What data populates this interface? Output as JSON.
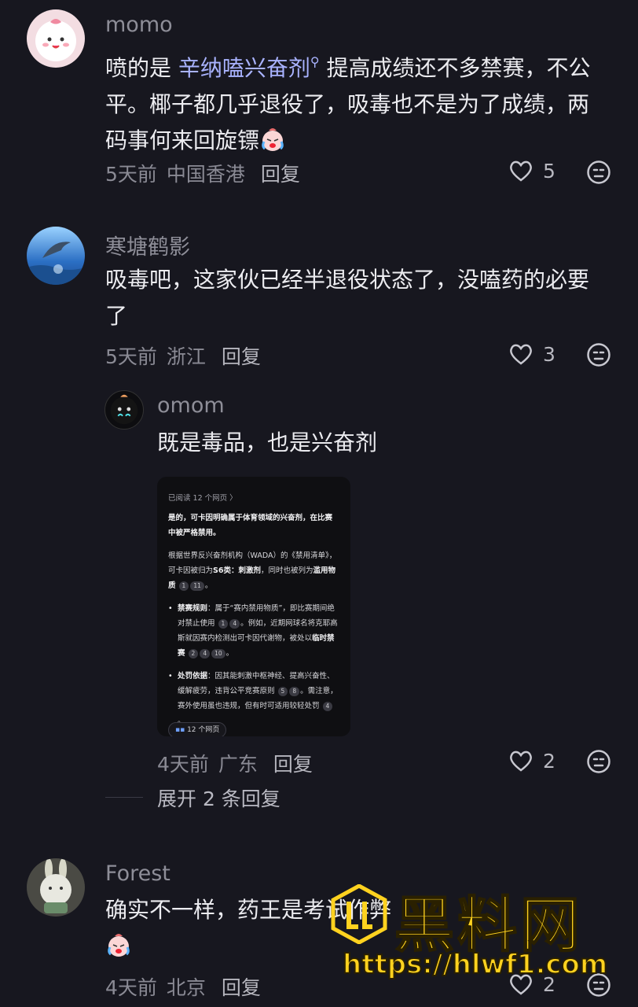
{
  "comments": [
    {
      "username": "momo",
      "text_before": "喷的是 ",
      "link": "辛纳嗑兴奋剂",
      "text_after": " 提高成绩还不多禁赛，不公平。椰子都几乎退役了，吸毒也不是为了成绩，两码事何来回旋镖",
      "time": "5天前",
      "location": "中国香港",
      "reply": "回复",
      "likes": "5"
    },
    {
      "username": "寒塘鹤影",
      "text": "吸毒吧，这家伙已经半退役状态了，没嗑药的必要了",
      "time": "5天前",
      "location": "浙江",
      "reply": "回复",
      "likes": "3"
    },
    {
      "username": "omom",
      "text": "既是毒品，也是兴奋剂",
      "time": "4天前",
      "location": "广东",
      "reply": "回复",
      "likes": "2"
    },
    {
      "username": "Forest",
      "text": "确实不一样，药王是考试作弊",
      "time": "4天前",
      "location": "北京",
      "reply": "回复",
      "likes": "2"
    }
  ],
  "expand_replies": "展开 2 条回复",
  "screenshot": {
    "read_pages": "已阅读 12 个网页 〉",
    "headline": "是的，可卡因明确属于体育领域的兴奋剂，在比赛中被严格禁用。",
    "para1_a": "根据世界反兴奋剂机构（WADA）的《禁用清单》，可卡因被归为",
    "para1_b": "S6类：刺激剂",
    "para1_c": "，同时也被列为",
    "para1_d": "滥用物质",
    "para1_refs": [
      "1",
      "11"
    ],
    "b1_title": "禁赛规则",
    "b1_text": "：属于“赛内禁用物质”，即比赛期间绝对禁止使用",
    "b1_refs": [
      "1",
      "4"
    ],
    "b1_text2": "。例如，近期网球名将克耶高斯就因赛内检测出可卡因代谢物，被处以",
    "b1_bold": "临时禁赛",
    "b1_refs2": [
      "2",
      "4",
      "10"
    ],
    "b2_title": "处罚依据",
    "b2_text": "：因其能刺激中枢神经、提高兴奋性、缓解疲劳，违背公平竞赛原则",
    "b2_refs": [
      "5",
      "8"
    ],
    "b2_text2": "。需注意，赛外使用虽也违规，但有时可适用较轻处罚",
    "b2_refs2": [
      "4"
    ],
    "pill": "12 个网页"
  },
  "watermark": {
    "title": "黑料网",
    "url": "https://hlwf1.com"
  },
  "colors": {
    "background": "#17171f",
    "link": "#a9b3ff",
    "watermark": "#ffd21f"
  }
}
